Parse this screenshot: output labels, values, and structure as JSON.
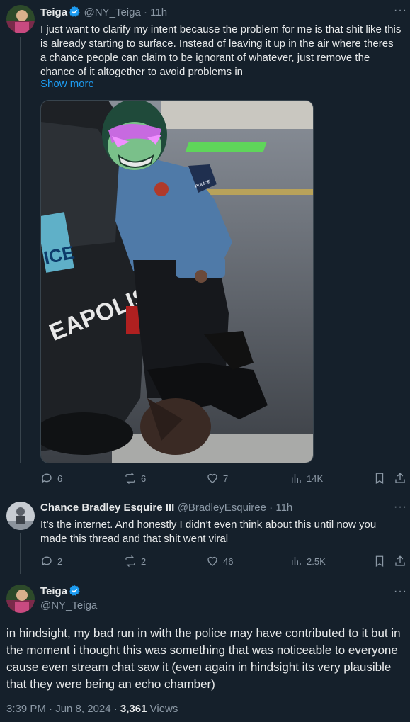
{
  "tweet1": {
    "display_name": "Teiga",
    "handle": "@NY_Teiga",
    "time": "11h",
    "text": "I just want to clarify my intent because the problem for me is that shit like this is already starting to surface. Instead of leaving it up in the air where theres a chance people can claim to be ignorant of whatever, just remove the chance of it altogether to avoid problems in",
    "show_more": "Show more",
    "image_text": "EAPOLIS",
    "plate_text": "ICE",
    "patch_text": "POLICE",
    "actions": {
      "replies": "6",
      "reposts": "6",
      "likes": "7",
      "views": "14K"
    }
  },
  "tweet2": {
    "display_name": "Chance Bradley Esquire III",
    "handle": "@BradleyEsquiree",
    "time": "11h",
    "text": "It’s the internet. And honestly I didn’t even think about this until now you made this thread and that shit went viral",
    "actions": {
      "replies": "2",
      "reposts": "2",
      "likes": "46",
      "views": "2.5K"
    }
  },
  "tweet3": {
    "display_name": "Teiga",
    "handle": "@NY_Teiga",
    "text": "in hindsight, my bad run in with the police may have contributed to it but in the moment i thought this was something that was noticeable to everyone cause even stream chat saw it (even again in hindsight its very plausible that they were being an echo chamber)",
    "timestamp": "3:39 PM · Jun 8, 2024 · ",
    "views_count": "3,361",
    "views_label": " Views"
  },
  "separator": " · ",
  "more_icon": "···",
  "colors": {
    "bg": "#15202b",
    "accent": "#1d9bf0",
    "muted": "#8b98a5",
    "divider": "#38444d"
  }
}
